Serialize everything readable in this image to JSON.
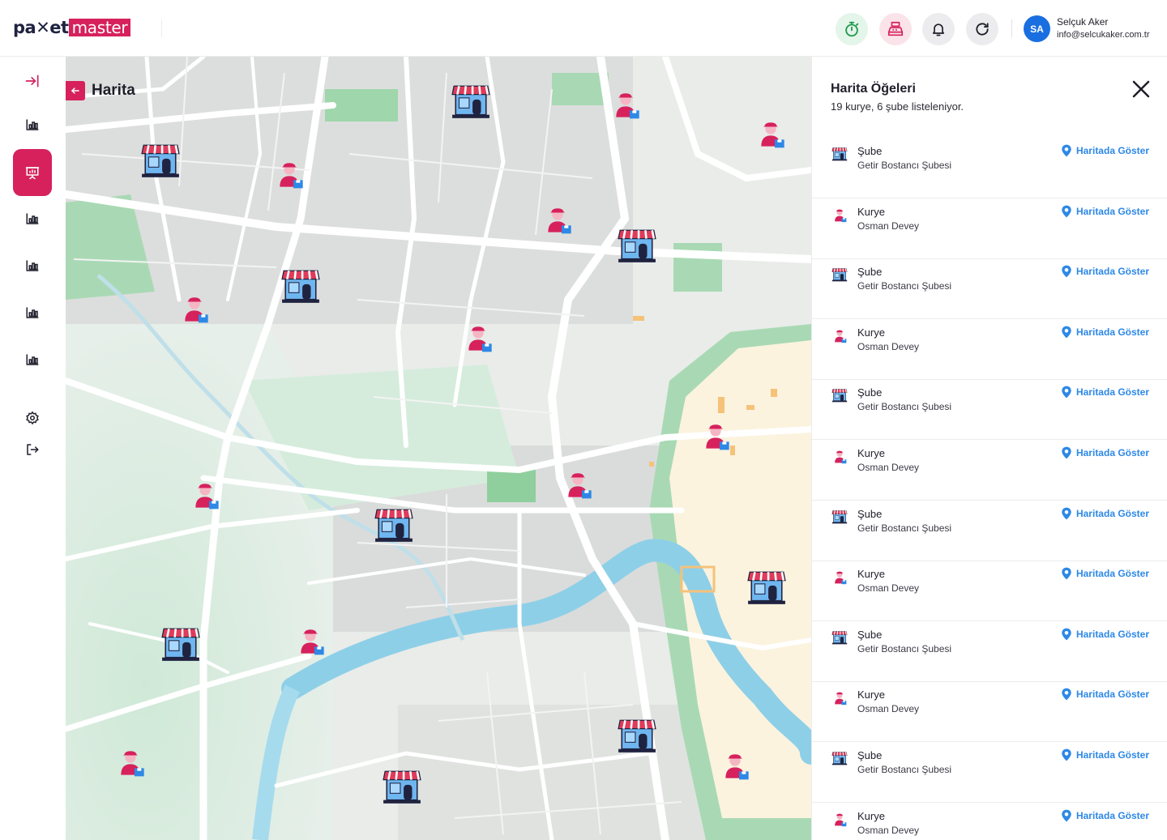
{
  "brand": {
    "part1": "pa✕et",
    "part2": "master"
  },
  "header": {
    "user": {
      "initials": "SA",
      "name": "Selçuk Aker",
      "email": "info@selcukaker.com.tr"
    },
    "icons": [
      "timer-icon",
      "cash-register-icon",
      "bell-icon",
      "refresh-icon"
    ]
  },
  "sidebar": {
    "items": [
      "collapse-icon",
      "chart-icon",
      "presentation-icon",
      "chart-icon",
      "chart-icon",
      "chart-icon",
      "chart-icon",
      "settings-icon",
      "logout-icon"
    ],
    "active_index": 2
  },
  "map": {
    "title": "Harita"
  },
  "panel": {
    "title": "Harita Öğeleri",
    "subtitle": "19 kurye, 6 şube listeleniyor.",
    "link_label": "Haritada Göster",
    "rows": [
      {
        "kind": "shop",
        "type": "Şube",
        "name": "Getir Bostancı Şubesi"
      },
      {
        "kind": "courier",
        "type": "Kurye",
        "name": "Osman Devey"
      },
      {
        "kind": "shop",
        "type": "Şube",
        "name": "Getir Bostancı Şubesi"
      },
      {
        "kind": "courier",
        "type": "Kurye",
        "name": "Osman Devey"
      },
      {
        "kind": "shop",
        "type": "Şube",
        "name": "Getir Bostancı Şubesi"
      },
      {
        "kind": "courier",
        "type": "Kurye",
        "name": "Osman Devey"
      },
      {
        "kind": "shop",
        "type": "Şube",
        "name": "Getir Bostancı Şubesi"
      },
      {
        "kind": "courier",
        "type": "Kurye",
        "name": "Osman Devey"
      },
      {
        "kind": "shop",
        "type": "Şube",
        "name": "Getir Bostancı Şubesi"
      },
      {
        "kind": "courier",
        "type": "Kurye",
        "name": "Osman Devey"
      },
      {
        "kind": "shop",
        "type": "Şube",
        "name": "Getir Bostancı Şubesi"
      },
      {
        "kind": "courier",
        "type": "Kurye",
        "name": "Osman Devey"
      }
    ]
  },
  "colors": {
    "accent": "#d6215d",
    "link": "#2d88e6",
    "avatar": "#1a6fe0",
    "brand_dark": "#1f2340"
  }
}
